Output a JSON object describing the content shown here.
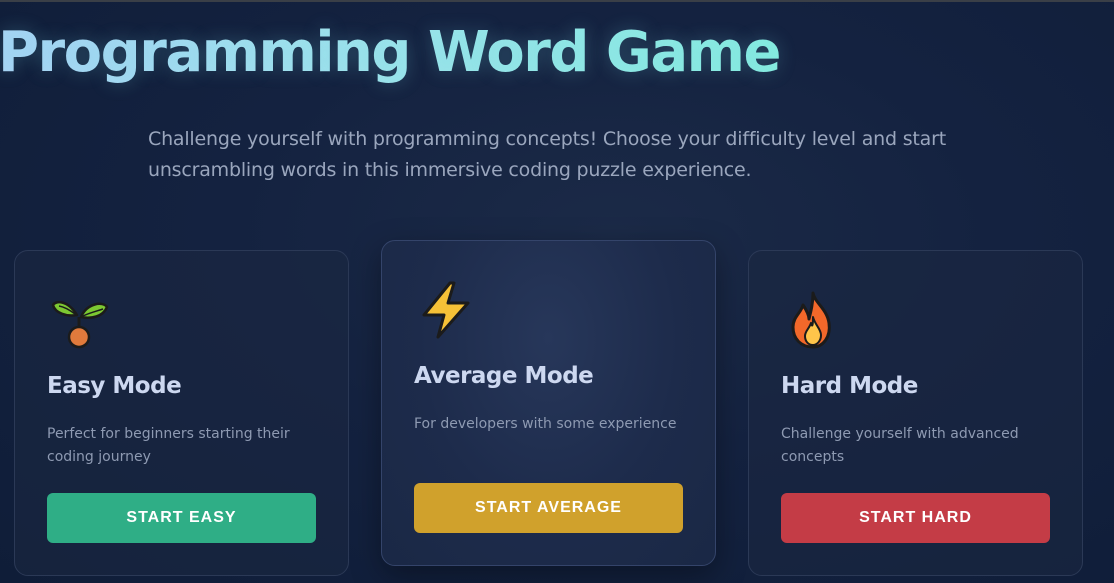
{
  "header": {
    "title": "Programming Word Game",
    "subtitle": "Challenge yourself with programming concepts! Choose your difficulty level and start unscrambling words in this immersive coding puzzle experience."
  },
  "modes": [
    {
      "icon": "seedling-icon",
      "title": "Easy Mode",
      "description": "Perfect for beginners starting their coding journey",
      "button_label": "START EASY",
      "button_color": "#2fae86"
    },
    {
      "icon": "lightning-icon",
      "title": "Average Mode",
      "description": "For developers with some experience",
      "button_label": "START AVERAGE",
      "button_color": "#d0a12c"
    },
    {
      "icon": "fire-icon",
      "title": "Hard Mode",
      "description": "Challenge yourself with advanced concepts",
      "button_label": "START HARD",
      "button_color": "#c43c46"
    }
  ]
}
